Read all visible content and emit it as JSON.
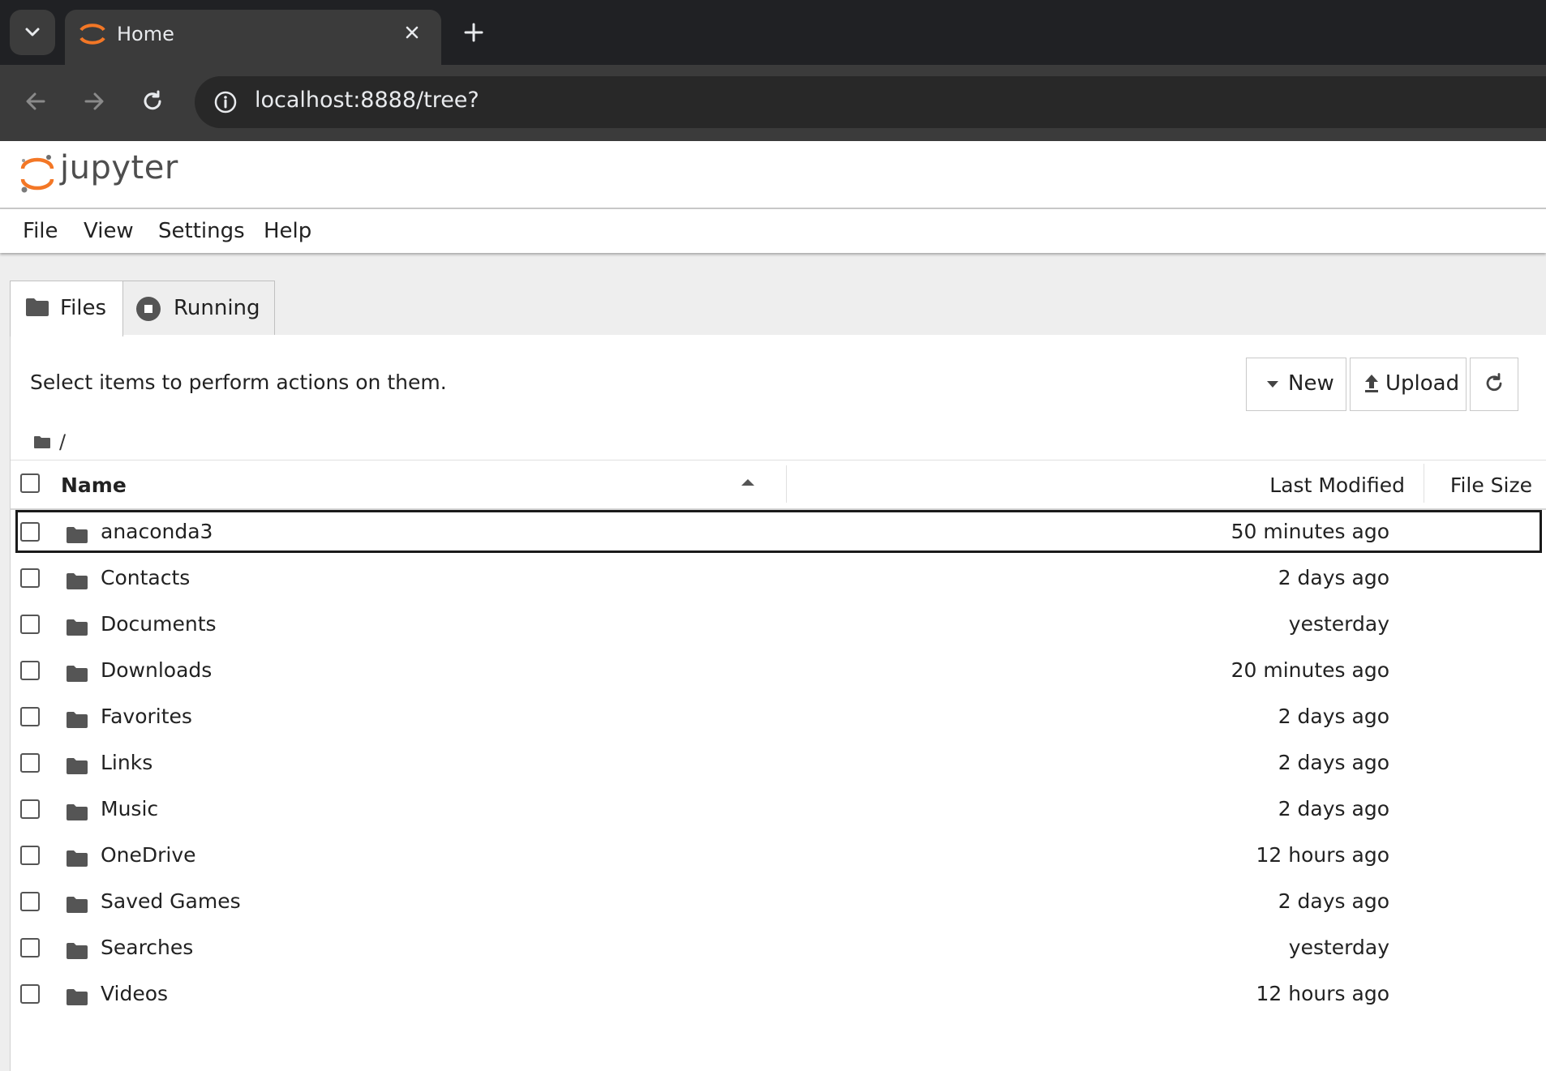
{
  "browser": {
    "tab_title": "Home",
    "url": "localhost:8888/tree?"
  },
  "app": {
    "logo_text": "jupyter",
    "menu": [
      "File",
      "View",
      "Settings",
      "Help"
    ],
    "accent_color": "#f37726"
  },
  "tabs": [
    {
      "label": "Files",
      "icon": "folder-icon",
      "active": true
    },
    {
      "label": "Running",
      "icon": "stop-circle-icon",
      "active": false
    }
  ],
  "toolbar": {
    "hint": "Select items to perform actions on them.",
    "new_label": "New",
    "upload_label": "Upload",
    "refresh_icon": "refresh-icon"
  },
  "breadcrumb": {
    "path": "/"
  },
  "list_header": {
    "name": "Name",
    "last_modified": "Last Modified",
    "file_size": "File Size",
    "sort": "ascending"
  },
  "items": [
    {
      "name": "anaconda3",
      "modified": "50 minutes ago",
      "selected": true
    },
    {
      "name": "Contacts",
      "modified": "2 days ago"
    },
    {
      "name": "Documents",
      "modified": "yesterday"
    },
    {
      "name": "Downloads",
      "modified": "20 minutes ago"
    },
    {
      "name": "Favorites",
      "modified": "2 days ago"
    },
    {
      "name": "Links",
      "modified": "2 days ago"
    },
    {
      "name": "Music",
      "modified": "2 days ago"
    },
    {
      "name": "OneDrive",
      "modified": "12 hours ago"
    },
    {
      "name": "Saved Games",
      "modified": "2 days ago"
    },
    {
      "name": "Searches",
      "modified": "yesterday"
    },
    {
      "name": "Videos",
      "modified": "12 hours ago"
    }
  ]
}
